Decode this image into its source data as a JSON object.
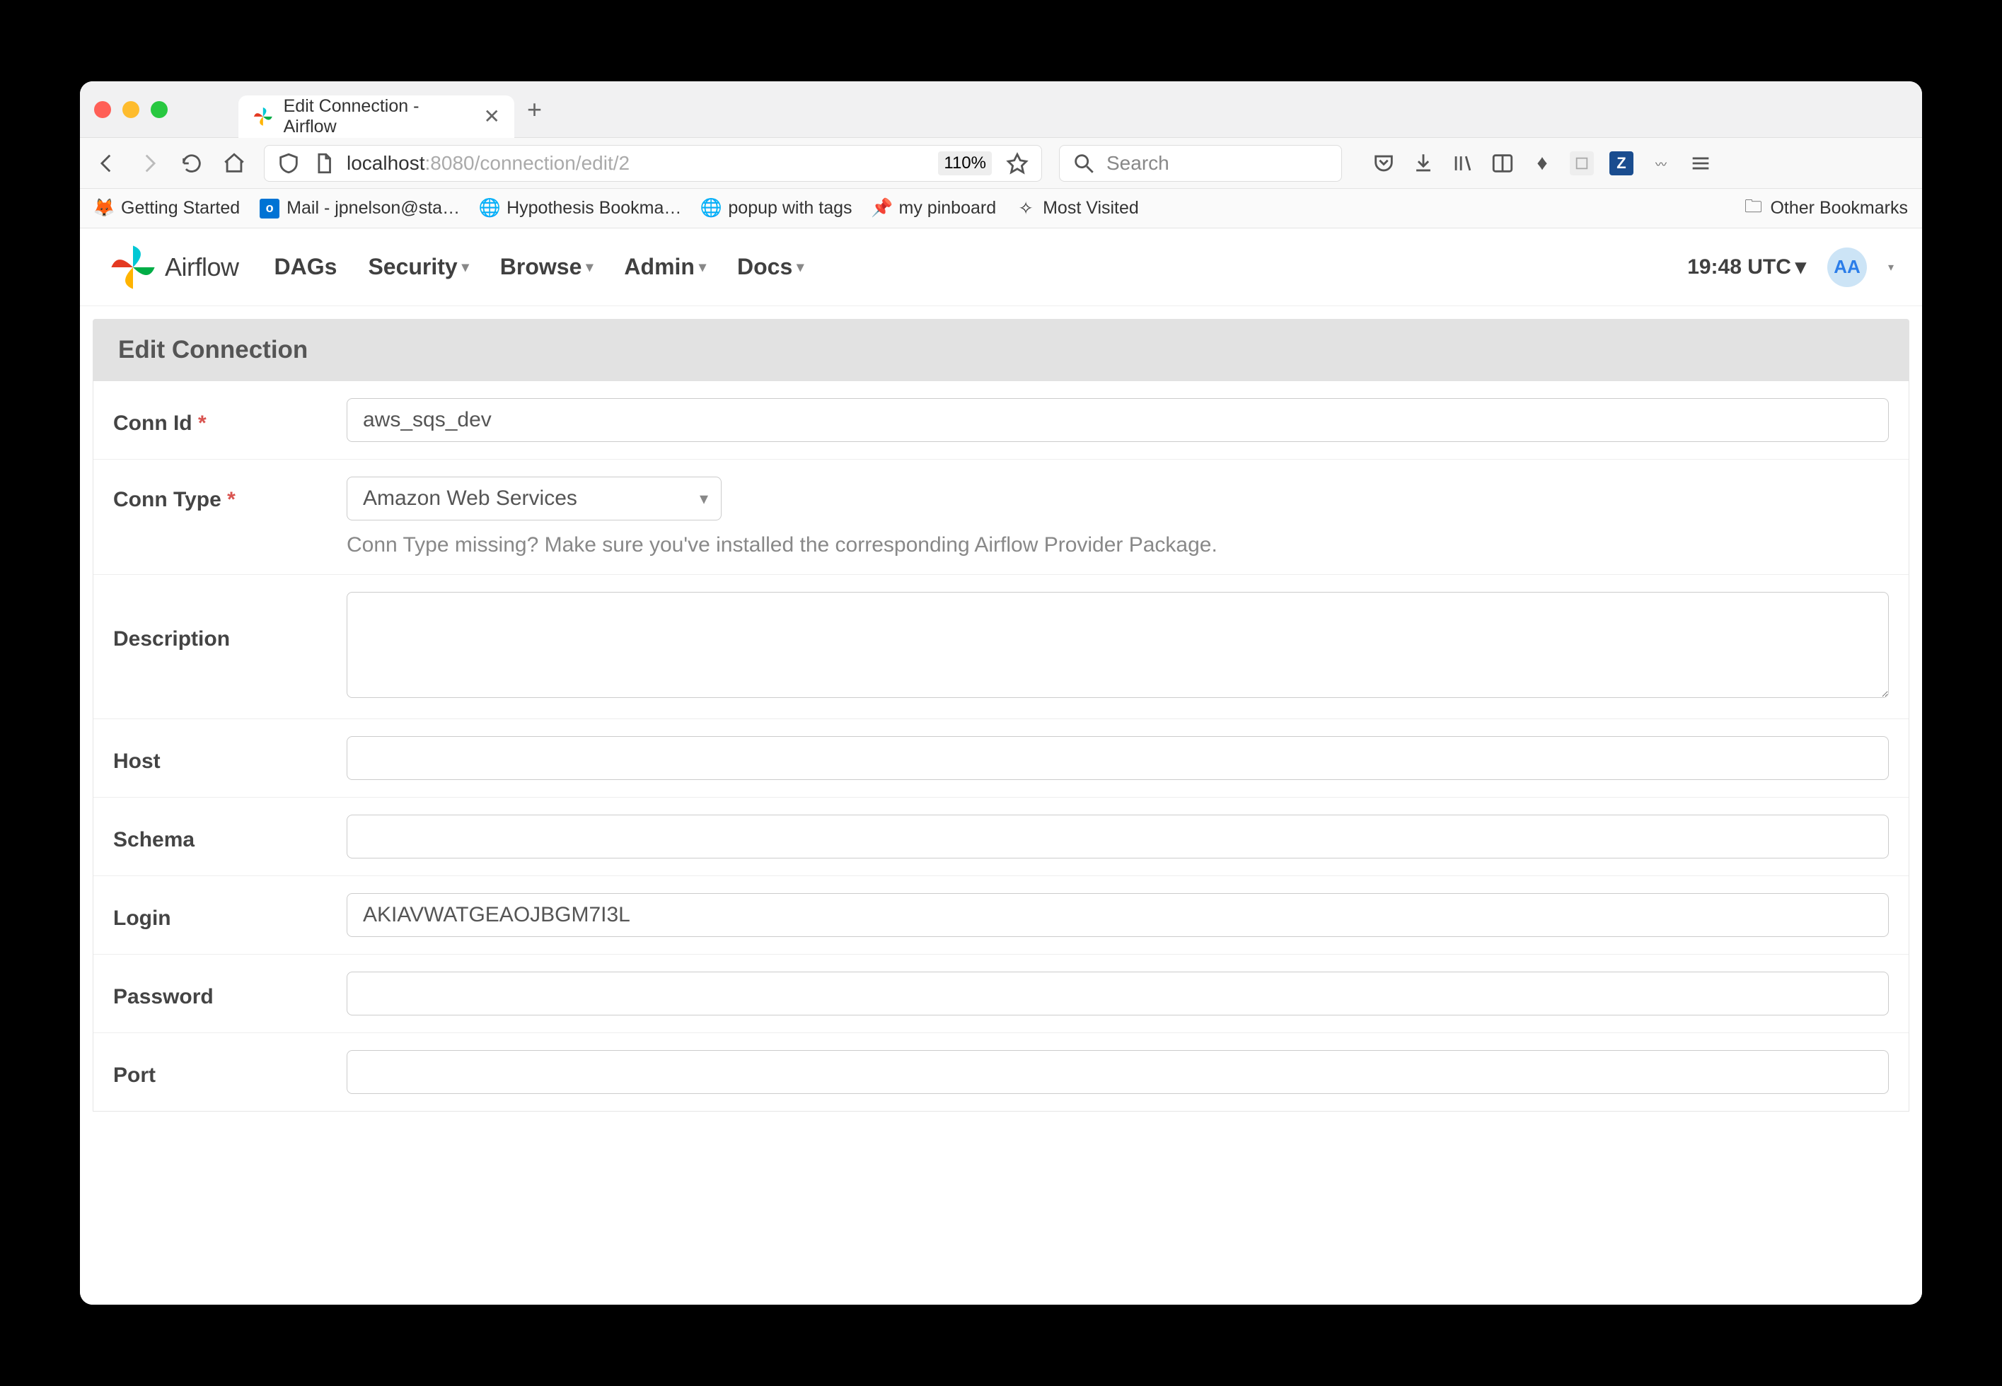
{
  "browser": {
    "tab_title": "Edit Connection - Airflow",
    "url_proto": "",
    "url_host": "localhost",
    "url_port": ":8080",
    "url_path": "/connection/edit/2",
    "zoom": "110%",
    "search_placeholder": "Search"
  },
  "bookmarks": [
    "Getting Started",
    "Mail - jpnelson@sta…",
    "Hypothesis Bookma…",
    "popup with tags",
    "my pinboard",
    "Most Visited"
  ],
  "bookmarks_right": "Other Bookmarks",
  "airflow": {
    "brand": "Airflow",
    "nav": [
      "DAGs",
      "Security",
      "Browse",
      "Admin",
      "Docs"
    ],
    "time": "19:48 UTC",
    "avatar": "AA"
  },
  "page": {
    "title": "Edit Connection"
  },
  "form": {
    "conn_id": {
      "label": "Conn Id",
      "required": true,
      "value": "aws_sqs_dev"
    },
    "conn_type": {
      "label": "Conn Type",
      "required": true,
      "value": "Amazon Web Services",
      "help": "Conn Type missing? Make sure you've installed the corresponding Airflow Provider Package."
    },
    "description": {
      "label": "Description",
      "value": ""
    },
    "host": {
      "label": "Host",
      "value": ""
    },
    "schema": {
      "label": "Schema",
      "value": ""
    },
    "login": {
      "label": "Login",
      "value": "AKIAVWATGEAOJBGM7I3L"
    },
    "password": {
      "label": "Password",
      "value": ""
    },
    "port": {
      "label": "Port",
      "value": ""
    }
  }
}
